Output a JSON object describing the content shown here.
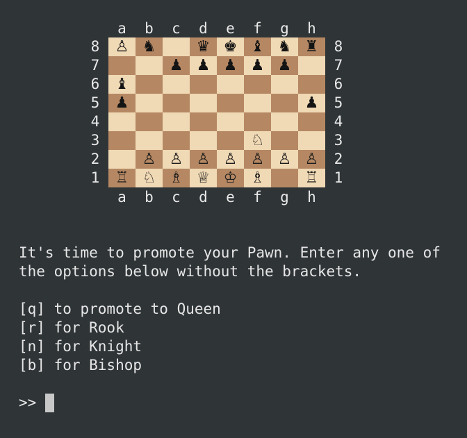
{
  "board": {
    "files": [
      "a",
      "b",
      "c",
      "d",
      "e",
      "f",
      "g",
      "h"
    ],
    "ranks": [
      "8",
      "7",
      "6",
      "5",
      "4",
      "3",
      "2",
      "1"
    ],
    "squares": [
      [
        "♙",
        "♞",
        "",
        "♛",
        "♚",
        "♝",
        "♞",
        "♜"
      ],
      [
        "",
        "",
        "♟",
        "♟",
        "♟",
        "♟",
        "♟",
        ""
      ],
      [
        "♝",
        "",
        "",
        "",
        "",
        "",
        "",
        ""
      ],
      [
        "♟",
        "",
        "",
        "",
        "",
        "",
        "",
        "♟"
      ],
      [
        "",
        "",
        "",
        "",
        "",
        "",
        "",
        ""
      ],
      [
        "",
        "",
        "",
        "",
        "",
        "♘",
        "",
        ""
      ],
      [
        "",
        "♙",
        "♙",
        "♙",
        "♙",
        "♙",
        "♙",
        "♙"
      ],
      [
        "♖",
        "♘",
        "♗",
        "♕",
        "♔",
        "♗",
        "",
        "♖"
      ]
    ],
    "light_color": "#f0d9b5",
    "dark_color": "#b58863"
  },
  "prompt": {
    "lines": [
      "It's time to promote your Pawn. Enter any one of",
      "the options below without the brackets."
    ],
    "options": [
      "[q] to promote to Queen",
      "[r] for Rook",
      "[n] for Knight",
      "[b] for Bishop"
    ],
    "input_prompt": ">>"
  }
}
